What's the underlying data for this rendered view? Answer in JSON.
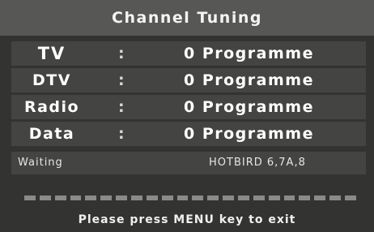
{
  "title": "Channel Tuning",
  "rows": [
    {
      "label": "TV",
      "colon": ":",
      "value": "0 Programme"
    },
    {
      "label": "DTV",
      "colon": ":",
      "value": "0 Programme"
    },
    {
      "label": "Radio",
      "colon": ":",
      "value": "0 Programme"
    },
    {
      "label": "Data",
      "colon": ":",
      "value": "0 Programme"
    }
  ],
  "status": {
    "state": "Waiting",
    "satellite": "HOTBIRD 6,7A,8"
  },
  "progress": {
    "fraction": 0.0
  },
  "footer": "Please press MENU key to exit",
  "colors": {
    "background": "#333432",
    "title_bar": "#575855",
    "row_bg": "#444542",
    "progress_seg": "#8a8b88"
  }
}
